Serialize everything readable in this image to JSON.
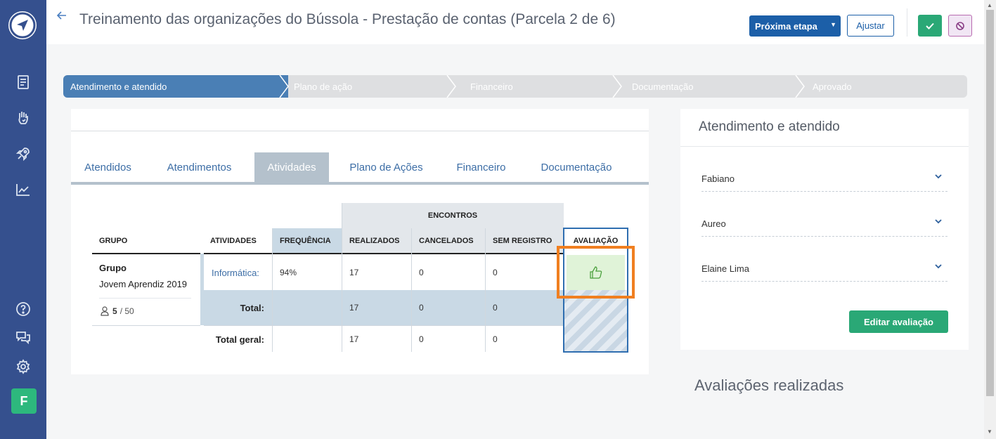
{
  "header": {
    "title": "Treinamento das organizações do Bússola - Prestação de contas (Parcela 2 de 6)",
    "next_step_label": "Próxima etapa",
    "adjust_label": "Ajustar"
  },
  "sidebar": {
    "items": [
      "document-icon",
      "hand-heart-icon",
      "rocket-icon",
      "chart-line-icon",
      "help-icon",
      "chat-icon",
      "gear-icon"
    ],
    "avatar_letter": "F"
  },
  "steps": [
    {
      "label": "Atendimento e atendido",
      "active": true
    },
    {
      "label": "Plano de ação",
      "active": false
    },
    {
      "label": "Financeiro",
      "active": false
    },
    {
      "label": "Documentação",
      "active": false
    },
    {
      "label": "Aprovado",
      "active": false
    }
  ],
  "tabs": [
    {
      "label": "Atendidos",
      "active": false
    },
    {
      "label": "Atendimentos",
      "active": false
    },
    {
      "label": "Atividades",
      "active": true
    },
    {
      "label": "Plano de Ações",
      "active": false
    },
    {
      "label": "Financeiro",
      "active": false
    },
    {
      "label": "Documentação",
      "active": false
    }
  ],
  "table": {
    "group_header": "ENCONTROS",
    "columns": {
      "grupo": "GRUPO",
      "atividades": "ATIVIDADES",
      "frequencia": "FREQUÊNCIA",
      "realizados": "REALIZADOS",
      "cancelados": "CANCELADOS",
      "sem_registro": "SEM REGISTRO",
      "avaliacao": "AVALIAÇÃO"
    },
    "group": {
      "title": "Grupo",
      "name": "Jovem Aprendiz 2019",
      "count": "5",
      "capacity": "/ 50"
    },
    "row": {
      "atividade": "Informática:",
      "frequencia": "94%",
      "realizados": "17",
      "cancelados": "0",
      "sem_registro": "0"
    },
    "total": {
      "label": "Total:",
      "realizados": "17",
      "cancelados": "0",
      "sem_registro": "0"
    },
    "total_geral": {
      "label": "Total geral:",
      "realizados": "17",
      "cancelados": "0",
      "sem_registro": "0"
    }
  },
  "panel": {
    "title": "Atendimento e atendido",
    "selects": [
      "Fabiano",
      "Aureo",
      "Elaine Lima"
    ],
    "edit_button": "Editar avaliação",
    "section_title": "Avaliações realizadas"
  },
  "colors": {
    "sidebar": "#35508e",
    "primary": "#1c5fa8",
    "success": "#2aa876",
    "highlight": "#f07f20"
  }
}
